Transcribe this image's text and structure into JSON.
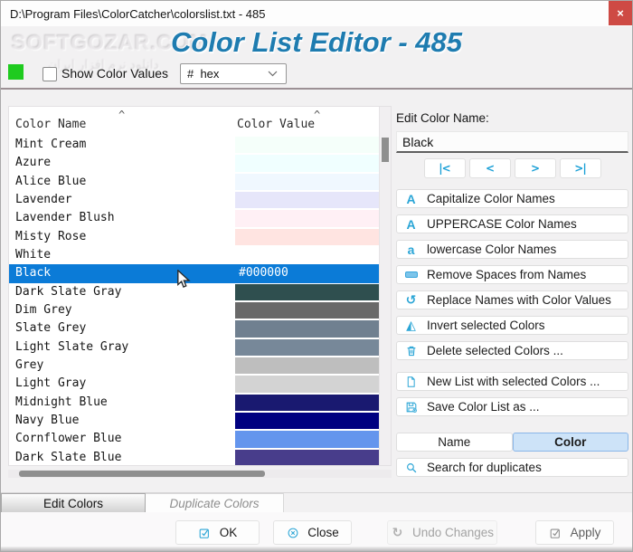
{
  "window": {
    "title": "D:\\Program Files\\ColorCatcher\\colorslist.txt - 485",
    "close_glyph": "×"
  },
  "header": {
    "app_title": "Color List Editor - 485",
    "watermark": "SOFTGOZAR.COM",
    "watermark_sub": "دانلود نرم افزار ایران"
  },
  "toolbar": {
    "swatch_color": "#1FCB1F",
    "show_values_label": "Show Color Values",
    "show_values_checked": false,
    "format_value": "#  hex"
  },
  "table": {
    "columns": [
      {
        "label": "Color Name",
        "sorted": "asc"
      },
      {
        "label": "Color Value",
        "sorted": "asc"
      }
    ],
    "selection_color": "#0B7BD7",
    "rows": [
      {
        "name": "Mint Cream",
        "swatch": "#F5FFFA",
        "value_text": "",
        "selected": false
      },
      {
        "name": "Azure",
        "swatch": "#F0FFFF",
        "value_text": "",
        "selected": false
      },
      {
        "name": "Alice Blue",
        "swatch": "#F0F8FF",
        "value_text": "",
        "selected": false
      },
      {
        "name": "Lavender",
        "swatch": "#E6E6FA",
        "value_text": "",
        "selected": false
      },
      {
        "name": "Lavender Blush",
        "swatch": "#FFF0F5",
        "value_text": "",
        "selected": false
      },
      {
        "name": "Misty Rose",
        "swatch": "#FFE4E1",
        "value_text": "",
        "selected": false
      },
      {
        "name": "White",
        "swatch": "#FFFFFF",
        "value_text": "",
        "selected": false
      },
      {
        "name": "Black",
        "swatch": "#000000",
        "value_text": "#000000",
        "selected": true
      },
      {
        "name": "Dark Slate Gray",
        "swatch": "#2F4F4F",
        "value_text": "",
        "selected": false
      },
      {
        "name": "Dim Grey",
        "swatch": "#696969",
        "value_text": "",
        "selected": false
      },
      {
        "name": "Slate Grey",
        "swatch": "#708090",
        "value_text": "",
        "selected": false
      },
      {
        "name": "Light Slate Gray",
        "swatch": "#778899",
        "value_text": "",
        "selected": false
      },
      {
        "name": "Grey",
        "swatch": "#BEBEBE",
        "value_text": "",
        "selected": false
      },
      {
        "name": "Light Gray",
        "swatch": "#D3D3D3",
        "value_text": "",
        "selected": false
      },
      {
        "name": "Midnight Blue",
        "swatch": "#191970",
        "value_text": "",
        "selected": false
      },
      {
        "name": "Navy Blue",
        "swatch": "#000080",
        "value_text": "",
        "selected": false
      },
      {
        "name": "Cornflower Blue",
        "swatch": "#6495ED",
        "value_text": "",
        "selected": false
      },
      {
        "name": "Dark Slate Blue",
        "swatch": "#483D8B",
        "value_text": "",
        "selected": false
      }
    ]
  },
  "editor": {
    "label": "Edit Color Name:",
    "value": "Black",
    "nav_buttons": [
      {
        "name": "first",
        "glyph": "|<"
      },
      {
        "name": "previous",
        "glyph": "<"
      },
      {
        "name": "next",
        "glyph": ">"
      },
      {
        "name": "last",
        "glyph": ">|"
      }
    ],
    "action_groups": [
      {
        "items": [
          {
            "icon": "capitalize",
            "label": "Capitalize Color Names"
          },
          {
            "icon": "uppercase",
            "label": "UPPERCASE Color Names"
          },
          {
            "icon": "lowercase",
            "label": "lowercase Color Names"
          },
          {
            "icon": "remove-spaces",
            "label": "Remove Spaces from Names"
          },
          {
            "icon": "undo-arrow",
            "label": "Replace Names with Color Values"
          },
          {
            "icon": "invert",
            "label": "Invert selected Colors"
          },
          {
            "icon": "trash",
            "label": "Delete selected Colors ..."
          }
        ]
      },
      {
        "items": [
          {
            "icon": "new-document",
            "label": "New List with selected Colors ..."
          },
          {
            "icon": "save",
            "label": "Save Color List as ..."
          }
        ]
      }
    ],
    "mode_toggle": [
      {
        "label": "Name",
        "active": false
      },
      {
        "label": "Color",
        "active": true
      }
    ],
    "search": {
      "icon": "search",
      "label": "Search for duplicates"
    }
  },
  "tabs": [
    {
      "label": "Edit Colors",
      "active": true
    },
    {
      "label": "Duplicate Colors",
      "active": false
    }
  ],
  "footer": {
    "buttons": [
      {
        "icon": "check-square",
        "label": "OK",
        "state": "normal"
      },
      {
        "icon": "close-circle",
        "label": "Close",
        "state": "normal"
      },
      {
        "icon": "refresh",
        "label": "Undo Changes",
        "state": "disabled"
      },
      {
        "icon": "check-square",
        "label": "Apply",
        "state": "muted"
      }
    ]
  },
  "colors": {
    "accent_icon": "#2AA5D6",
    "selection": "#0B7BD7",
    "close_button": "#CE4A44"
  }
}
